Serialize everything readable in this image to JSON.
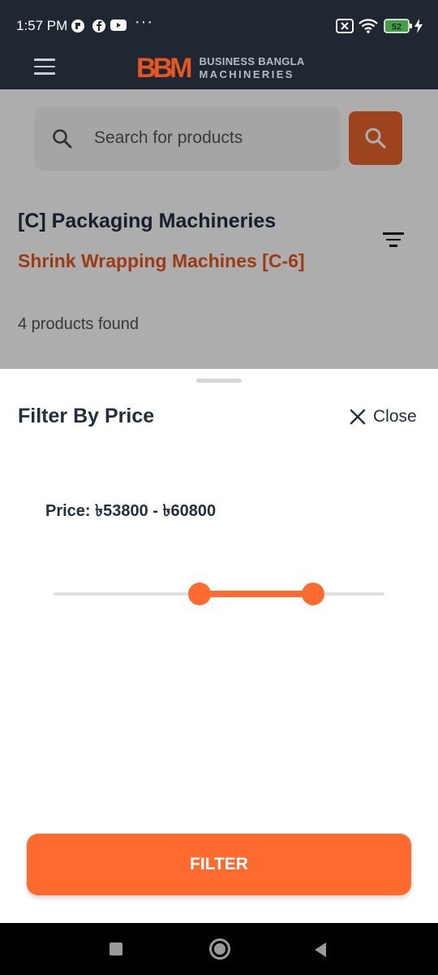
{
  "status_bar": {
    "time": "1:57 PM",
    "more": "···",
    "battery": "52"
  },
  "header": {
    "logo_mark": "BBM",
    "logo_line1": "BUSINESS BANGLA",
    "logo_line2": "MACHINERIES"
  },
  "search": {
    "placeholder": "Search for products"
  },
  "category": {
    "title": "[C] Packaging Machineries",
    "subtitle": "Shrink Wrapping Machines [C-6]",
    "products_found": "4 products found"
  },
  "filter_sheet": {
    "title": "Filter By Price",
    "close_label": "Close",
    "price_label": "Price: ৳53800 - ৳60800",
    "slider": {
      "low_fraction": 0.441,
      "high_fraction": 0.784
    },
    "filter_button": "FILTER"
  },
  "colors": {
    "accent": "#ff6a2e",
    "brand_dark": "#1f2733",
    "text_dark": "#222f3e"
  }
}
